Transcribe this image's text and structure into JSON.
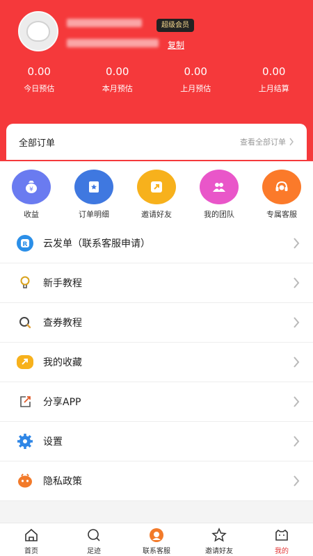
{
  "profile": {
    "vip_badge": "超级会员",
    "copy_label": "复制"
  },
  "stats": [
    {
      "value": "0.00",
      "label": "今日预估"
    },
    {
      "value": "0.00",
      "label": "本月预估"
    },
    {
      "value": "0.00",
      "label": "上月预估"
    },
    {
      "value": "0.00",
      "label": "上月结算"
    }
  ],
  "orders": {
    "title": "全部订单",
    "view_all": "查看全部订单"
  },
  "quick_actions": [
    {
      "label": "收益",
      "icon": "money-bag-icon",
      "color": "#6a7bf0"
    },
    {
      "label": "订单明细",
      "icon": "order-detail-icon",
      "color": "#3f78e0"
    },
    {
      "label": "邀请好友",
      "icon": "share-arrow-icon",
      "color": "#f7b11c"
    },
    {
      "label": "我的团队",
      "icon": "team-icon",
      "color": "#e956c9"
    },
    {
      "label": "专属客服",
      "icon": "headset-icon",
      "color": "#fb7a2a"
    }
  ],
  "menu": [
    {
      "label": "云发单（联系客服申请）",
      "icon": "cloud-r-icon"
    },
    {
      "label": "新手教程",
      "icon": "lightbulb-icon"
    },
    {
      "label": "查券教程",
      "icon": "search-icon"
    },
    {
      "label": "我的收藏",
      "icon": "favorites-icon"
    },
    {
      "label": "分享APP",
      "icon": "share-icon"
    },
    {
      "label": "设置",
      "icon": "gear-icon"
    },
    {
      "label": "隐私政策",
      "icon": "privacy-icon"
    }
  ],
  "tabs": [
    {
      "label": "首页",
      "icon": "home-icon",
      "active": false
    },
    {
      "label": "足迹",
      "icon": "footprint-icon",
      "active": false
    },
    {
      "label": "联系客服",
      "icon": "service-icon",
      "active": false
    },
    {
      "label": "邀请好友",
      "icon": "star-icon",
      "active": false
    },
    {
      "label": "我的",
      "icon": "profile-icon",
      "active": true
    }
  ],
  "colors": {
    "brand_red": "#f5393b",
    "active_tab": "#e33b3b"
  }
}
